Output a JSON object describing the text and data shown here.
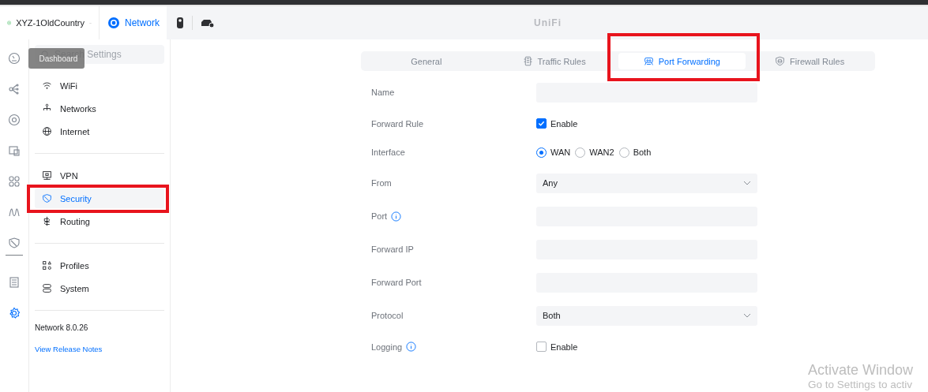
{
  "header": {
    "site": "XYZ-1OldCountry",
    "app": "Network",
    "brand": "UniFi"
  },
  "rail": [
    {
      "kind": "dashboard",
      "selected": false,
      "tooltip": "Dashboard"
    },
    {
      "kind": "topology",
      "selected": false
    },
    {
      "kind": "devices",
      "selected": false
    },
    {
      "kind": "clients",
      "selected": false
    },
    {
      "kind": "apps",
      "selected": false
    },
    {
      "kind": "insights",
      "selected": false
    },
    {
      "kind": "shield",
      "selected": false
    },
    {
      "kind": "divider"
    },
    {
      "kind": "logs",
      "selected": false
    },
    {
      "kind": "settings",
      "selected": true
    }
  ],
  "sidebar": {
    "search": {
      "placeholder": "Search Settings"
    },
    "groups": [
      [
        {
          "kind": "wifi",
          "label": "WiFi",
          "selected": false,
          "highlighted": false
        },
        {
          "kind": "networks",
          "label": "Networks",
          "selected": false,
          "highlighted": false
        },
        {
          "kind": "internet",
          "label": "Internet",
          "selected": false,
          "highlighted": false
        }
      ],
      [
        {
          "kind": "vpn",
          "label": "VPN",
          "selected": false,
          "highlighted": false
        },
        {
          "kind": "security",
          "label": "Security",
          "selected": true,
          "highlighted": true
        },
        {
          "kind": "routing",
          "label": "Routing",
          "selected": false,
          "highlighted": false
        }
      ],
      [
        {
          "kind": "profiles",
          "label": "Profiles",
          "selected": false,
          "highlighted": false
        },
        {
          "kind": "system",
          "label": "System",
          "selected": false,
          "highlighted": false
        }
      ]
    ],
    "version": "Network 8.0.26",
    "link": "View Release Notes"
  },
  "tabs": [
    {
      "kind": "general",
      "label": "General",
      "selected": false,
      "highlighted": false
    },
    {
      "kind": "traffic",
      "label": "Traffic Rules",
      "selected": false,
      "highlighted": false
    },
    {
      "kind": "forwarding",
      "label": "Port Forwarding",
      "selected": true,
      "highlighted": true
    },
    {
      "kind": "firewall",
      "label": "Firewall Rules",
      "selected": false,
      "highlighted": false
    }
  ],
  "form": [
    {
      "kind": "text",
      "label": "Name"
    },
    {
      "kind": "checkbox",
      "label": "Forward Rule",
      "option": "Enable",
      "checked": true
    },
    {
      "kind": "radio",
      "label": "Interface",
      "options": [
        {
          "label": "WAN",
          "selected": true
        },
        {
          "label": "WAN2",
          "selected": false
        },
        {
          "label": "Both",
          "selected": false
        }
      ]
    },
    {
      "kind": "select",
      "label": "From",
      "value": "Any"
    },
    {
      "kind": "text",
      "label": "Port",
      "info": true
    },
    {
      "kind": "text",
      "label": "Forward IP"
    },
    {
      "kind": "text",
      "label": "Forward Port"
    },
    {
      "kind": "select",
      "label": "Protocol",
      "value": "Both"
    },
    {
      "kind": "checkbox",
      "label": "Logging",
      "info": true,
      "option": "Enable",
      "checked": false
    }
  ],
  "os_notice": {
    "title": "Activate Window",
    "text": "Go to Settings to activ"
  }
}
